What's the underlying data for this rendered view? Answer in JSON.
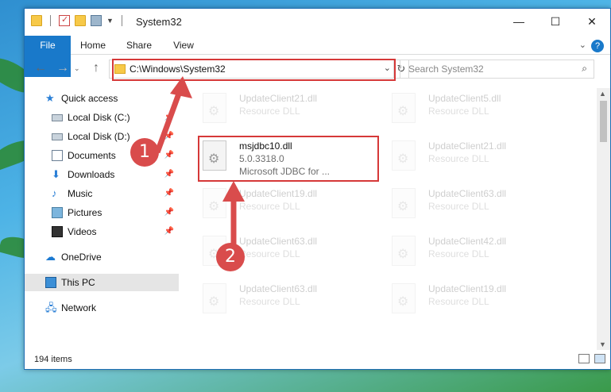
{
  "window": {
    "title": "System32"
  },
  "ribbon": {
    "tabs": [
      "File",
      "Home",
      "Share",
      "View"
    ]
  },
  "address": {
    "path": "C:\\Windows\\System32",
    "search_placeholder": "Search System32"
  },
  "sidebar": {
    "items": [
      {
        "label": "Quick access",
        "icon": "star-icon"
      },
      {
        "label": "Local Disk (C:)",
        "icon": "disk-icon",
        "pinned": true
      },
      {
        "label": "Local Disk (D:)",
        "icon": "disk-icon",
        "pinned": true
      },
      {
        "label": "Documents",
        "icon": "documents-icon",
        "pinned": true
      },
      {
        "label": "Downloads",
        "icon": "download-icon",
        "pinned": true
      },
      {
        "label": "Music",
        "icon": "music-icon",
        "pinned": true
      },
      {
        "label": "Pictures",
        "icon": "pictures-icon",
        "pinned": true
      },
      {
        "label": "Videos",
        "icon": "videos-icon",
        "pinned": true
      },
      {
        "label": "OneDrive",
        "icon": "cloud-icon"
      },
      {
        "label": "This PC",
        "icon": "pc-icon"
      },
      {
        "label": "Network",
        "icon": "network-icon"
      }
    ]
  },
  "files": [
    {
      "name": "UpdateClient21.dll",
      "type": "Resource DLL"
    },
    {
      "name": "UpdateClient5.dll",
      "type": "Resource DLL"
    },
    {
      "name": "msjdbc10.dll",
      "type": "5.0.3318.0",
      "desc": "Microsoft JDBC for ..."
    },
    {
      "name": "UpdateClient21.dll",
      "type": "Resource DLL"
    },
    {
      "name": "UpdateClient19.dll",
      "type": "Resource DLL"
    },
    {
      "name": "UpdateClient63.dll",
      "type": "Resource DLL"
    },
    {
      "name": "UpdateClient63.dll",
      "type": "Resource DLL"
    },
    {
      "name": "UpdateClient42.dll",
      "type": "Resource DLL"
    },
    {
      "name": "UpdateClient63.dll",
      "type": "Resource DLL"
    },
    {
      "name": "UpdateClient19.dll",
      "type": "Resource DLL"
    }
  ],
  "status": {
    "item_count": "194 items"
  },
  "callouts": [
    "1",
    "2"
  ],
  "colors": {
    "accent": "#1979ca",
    "highlight": "#d63838",
    "callout": "#d94c4c"
  }
}
